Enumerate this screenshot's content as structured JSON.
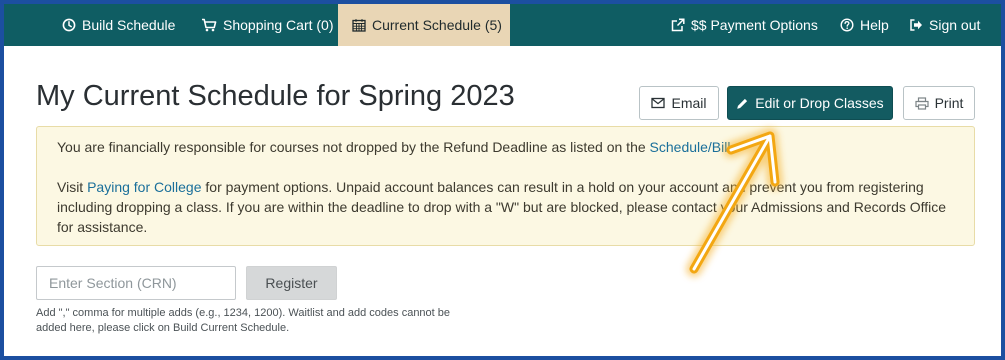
{
  "nav": {
    "build_schedule": "Build Schedule",
    "shopping_cart": "Shopping Cart (0)",
    "current_schedule": "Current Schedule (5)",
    "payment_options": "$$ Payment Options",
    "help": "Help",
    "sign_out": "Sign out"
  },
  "page": {
    "title": "My Current Schedule for Spring 2023"
  },
  "actions": {
    "email": "Email",
    "edit_drop": "Edit or Drop Classes",
    "print": "Print"
  },
  "alert": {
    "line1_prefix": "You are financially responsible for courses not dropped by the Refund Deadline as listed on the ",
    "line1_link": "Schedule/Bill",
    "line1_suffix": ".",
    "para2_prefix": "Visit ",
    "para2_link": "Paying for College",
    "para2_suffix": " for payment options. Unpaid account balances can result in a hold on your account and prevent you from registering including dropping a class. If you are within the deadline to drop with a \"W\" but are blocked, please contact your Admissions and Records Office for assistance."
  },
  "register": {
    "placeholder": "Enter Section (CRN)",
    "button": "Register",
    "hint": "Add \",\" comma for multiple adds (e.g., 1234, 1200). Waitlist and add codes cannot be added here, please click on Build Current Schedule."
  },
  "colors": {
    "nav_bg": "#0f5d63",
    "active_tab": "#e9d6b5",
    "primary": "#135b61",
    "alert_bg": "#fcf8e3",
    "annotation": "#f3a712",
    "outer_border": "#1c4fa0"
  },
  "icons": {
    "build_schedule": "clock-icon",
    "shopping_cart": "cart-icon",
    "current_schedule": "calendar-icon",
    "payment_options": "external-link-icon",
    "help": "question-circle-icon",
    "sign_out": "sign-out-icon",
    "email": "envelope-icon",
    "edit_drop": "pencil-icon",
    "print": "print-icon"
  }
}
